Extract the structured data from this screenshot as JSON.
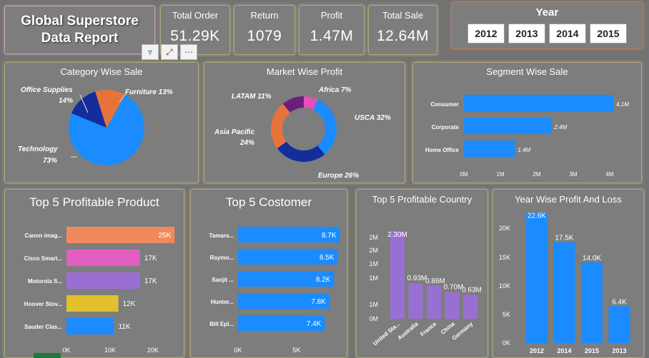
{
  "header": {
    "title": "Global Superstore Data Report",
    "kpis": [
      {
        "label": "Total Order",
        "value": "51.29K"
      },
      {
        "label": "Return",
        "value": "1079"
      },
      {
        "label": "Profit",
        "value": "1.47M"
      },
      {
        "label": "Total Sale",
        "value": "12.64M"
      }
    ],
    "year_slicer": {
      "label": "Year",
      "options": [
        "2012",
        "2013",
        "2014",
        "2015"
      ]
    }
  },
  "colors": {
    "blue": "#1a8cff",
    "orange": "#e8733a",
    "navy": "#152d9b",
    "purple": "#6b1f7a",
    "pink": "#e64fb8",
    "salmon": "#f08a5d",
    "violet": "#9a6fd4",
    "yellow": "#e1c12e"
  },
  "chart_data": [
    {
      "type": "pie",
      "title": "Category Wise Sale",
      "slices": [
        {
          "label": "Technology 73%",
          "value": 73,
          "color": "#1a8cff"
        },
        {
          "label": "Office Supplies 14%",
          "value": 14,
          "color": "#152d9b"
        },
        {
          "label": "Furniture 13%",
          "value": 13,
          "color": "#e8733a"
        }
      ]
    },
    {
      "type": "pie",
      "title": "Market Wise Profit",
      "slices": [
        {
          "label": "Africa 7%",
          "value": 7,
          "color": "#e64fb8"
        },
        {
          "label": "USCA 32%",
          "value": 32,
          "color": "#1a8cff"
        },
        {
          "label": "Europe 26%",
          "value": 26,
          "color": "#152d9b"
        },
        {
          "label": "Asia Pacific 24%",
          "value": 24,
          "color": "#e8733a"
        },
        {
          "label": "LATAM 11%",
          "value": 11,
          "color": "#6b1f7a"
        }
      ]
    },
    {
      "type": "bar",
      "title": "Segment Wise Sale",
      "orientation": "horizontal",
      "categories": [
        "Consumer",
        "Corporate",
        "Home Office"
      ],
      "values": [
        4.1,
        2.4,
        1.4
      ],
      "data_labels": [
        "4.1M",
        "2.4M",
        "1.4M"
      ],
      "xlim": [
        0,
        4
      ],
      "ticks": [
        "0M",
        "1M",
        "2M",
        "3M",
        "4M"
      ]
    },
    {
      "type": "bar",
      "title": "Top 5 Profitable Product",
      "orientation": "horizontal",
      "categories": [
        "Canon imag...",
        "Cisco Smart...",
        "Motorola S...",
        "Hoover Stov...",
        "Sauder Clas..."
      ],
      "values": [
        25,
        17,
        17,
        12,
        11
      ],
      "data_labels": [
        "25K",
        "17K",
        "17K",
        "12K",
        "11K"
      ],
      "colors": [
        "#f08a5d",
        "#e15fc0",
        "#9a6fd4",
        "#e1c12e",
        "#1a8cff"
      ],
      "xlim": [
        0,
        20
      ],
      "ticks": [
        "0K",
        "10K",
        "20K"
      ]
    },
    {
      "type": "bar",
      "title": "Top 5 Costomer",
      "orientation": "horizontal",
      "categories": [
        "Tamara...",
        "Raymo...",
        "Sanjit ...",
        "Hunter...",
        "Bill Epl..."
      ],
      "values": [
        8.7,
        8.5,
        8.2,
        7.8,
        7.4
      ],
      "data_labels": [
        "8.7K",
        "8.5K",
        "8.2K",
        "7.8K",
        "7.4K"
      ],
      "xlim": [
        0,
        5
      ],
      "ticks": [
        "0K",
        "5K"
      ]
    },
    {
      "type": "bar",
      "title": "Top 5 Profitable Country",
      "categories": [
        "United Sta...",
        "Australia",
        "France",
        "China",
        "Germany"
      ],
      "values": [
        2.3,
        0.93,
        0.86,
        0.7,
        0.63
      ],
      "data_labels": [
        "2.30M",
        "0.93M",
        "0.86M",
        "0.70M",
        "0.63M"
      ],
      "ylim": [
        0,
        2
      ],
      "ticks": [
        "0M",
        "1M",
        "1M",
        "1M",
        "2M",
        "2M"
      ]
    },
    {
      "type": "bar",
      "title": "Year Wise Profit And Loss",
      "categories": [
        "2012",
        "2014",
        "2015",
        "2013"
      ],
      "values": [
        22.6,
        17.5,
        14.0,
        6.4
      ],
      "data_labels": [
        "22.6K",
        "17.5K",
        "14.0K",
        "6.4K"
      ],
      "ylim": [
        0,
        20
      ],
      "ticks": [
        "0K",
        "5K",
        "10K",
        "15K",
        "20K"
      ]
    }
  ]
}
